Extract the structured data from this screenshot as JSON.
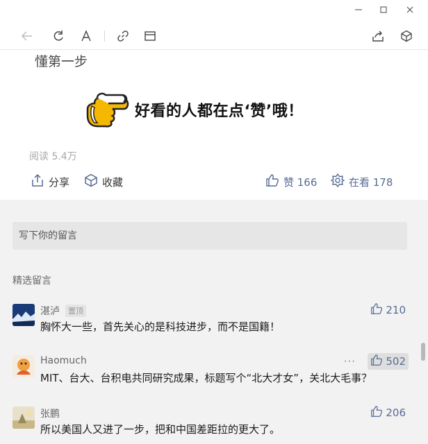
{
  "article": {
    "partial_title": "懂第一步",
    "promo_text": "好看的人都在点‘赞’哦！",
    "read_count": "阅读 5.4万"
  },
  "actions": {
    "share_label": "分享",
    "collect_label": "收藏",
    "like_label": "赞 166",
    "watch_label": "在看 178"
  },
  "comments_area": {
    "input_placeholder": "写下你的留言",
    "section_label": "精选留言",
    "items": [
      {
        "name": "湛泸",
        "tag": "置顶",
        "text": "胸怀大一些，首先关心的是科技进步，而不是国籍！",
        "likes": "210"
      },
      {
        "name": "Haomuch",
        "text": "MIT、台大、台积电共同研究成果，标题写个“北大才女”，关北大毛事？",
        "likes": "502",
        "more": "···"
      },
      {
        "name": "张鹏",
        "text": "所以美国人又进了一步，把和中国差距拉的更大了。",
        "likes": "206"
      }
    ]
  },
  "colors": {
    "link": "#576b95",
    "gray_bg": "#f2f2f2",
    "promo_yellow": "#f5b800"
  }
}
